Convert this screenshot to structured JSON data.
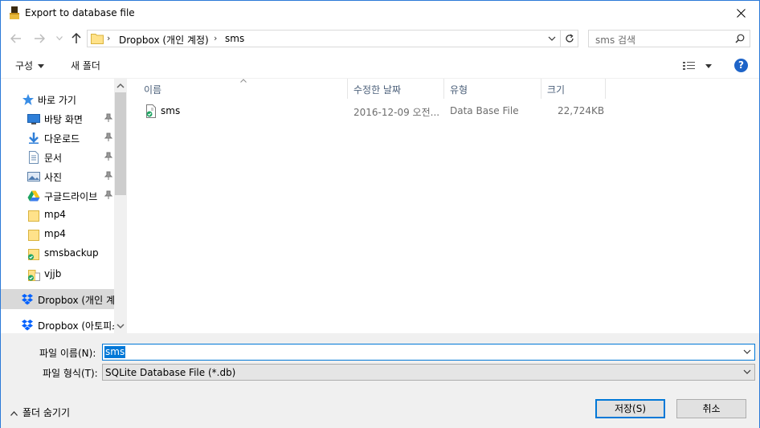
{
  "window": {
    "title": "Export to database file"
  },
  "address": {
    "crumbs": [
      "Dropbox (개인 계정)",
      "sms"
    ],
    "search_placeholder": "sms 검색"
  },
  "toolbar": {
    "organize": "구성",
    "new_folder": "새 폴더",
    "help": "?"
  },
  "nav": {
    "quick_access": "바로 가기",
    "items": [
      {
        "label": "바탕 화면",
        "icon": "desktop-icon",
        "pinned": true
      },
      {
        "label": "다운로드",
        "icon": "download-icon",
        "pinned": true
      },
      {
        "label": "문서",
        "icon": "document-icon",
        "pinned": true
      },
      {
        "label": "사진",
        "icon": "picture-icon",
        "pinned": true
      },
      {
        "label": "구글드라이브",
        "icon": "google-drive-icon",
        "pinned": true
      },
      {
        "label": "mp4",
        "icon": "folder-icon",
        "pinned": false
      },
      {
        "label": "mp4",
        "icon": "folder-icon",
        "pinned": false
      },
      {
        "label": "smsbackup",
        "icon": "synced-folder-icon",
        "pinned": false
      },
      {
        "label": "vjjb",
        "icon": "synced-folder-icon",
        "pinned": false
      }
    ],
    "dropbox_personal": "Dropbox (개인 계",
    "dropbox_other": "Dropbox (아토피스"
  },
  "columns": {
    "name": "이름",
    "modified": "수정한 날짜",
    "type": "유형",
    "size": "크기"
  },
  "files": [
    {
      "name": "sms",
      "modified": "2016-12-09 오전...",
      "type": "Data Base File",
      "size": "22,724KB"
    }
  ],
  "form": {
    "filename_label": "파일 이름(N):",
    "filename_value": "sms",
    "filetype_label": "파일 형식(T):",
    "filetype_value": "SQLite Database File (*.db)",
    "hide_folders": "폴더 숨기기",
    "save": "저장(S)",
    "cancel": "취소"
  },
  "colors": {
    "accent": "#0078d7",
    "help": "#1e64c8",
    "dropbox": "#0061fe"
  }
}
